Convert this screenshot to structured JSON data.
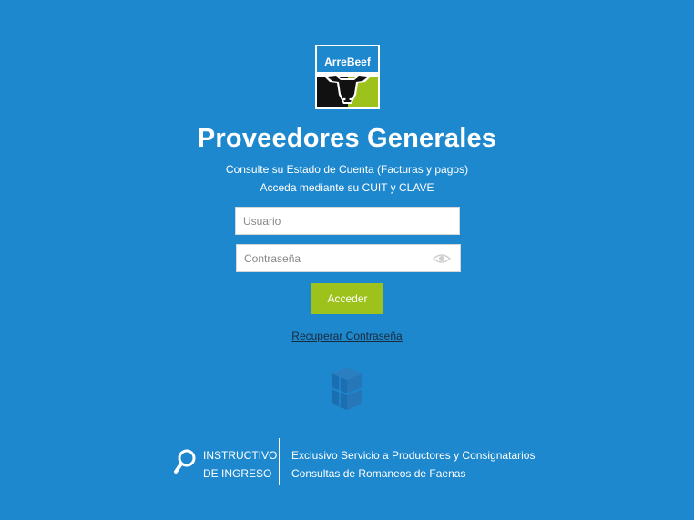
{
  "logo": {
    "text": "ArreBeef"
  },
  "header": {
    "title": "Proveedores Generales",
    "subtitle_1": "Consulte su Estado de Cuenta (Facturas y pagos)",
    "subtitle_2": "Acceda mediante su CUIT y CLAVE"
  },
  "form": {
    "username_placeholder": "Usuario",
    "password_placeholder": "Contraseña",
    "submit_label": "Acceder",
    "recover_label": "Recuperar Contraseña"
  },
  "footer": {
    "instructions_line1": "INSTRUCTIVO",
    "instructions_line2": "DE INGRESO",
    "info_line1": "Exclusivo Servicio a Productores y Consignatarios",
    "info_line2": "Consultas de Romaneos de Faenas"
  },
  "colors": {
    "background": "#1e88cf",
    "accent_green": "#9ec21c",
    "logo_black": "#111111"
  },
  "icons": [
    "eye-icon",
    "box-icon",
    "search-icon"
  ]
}
